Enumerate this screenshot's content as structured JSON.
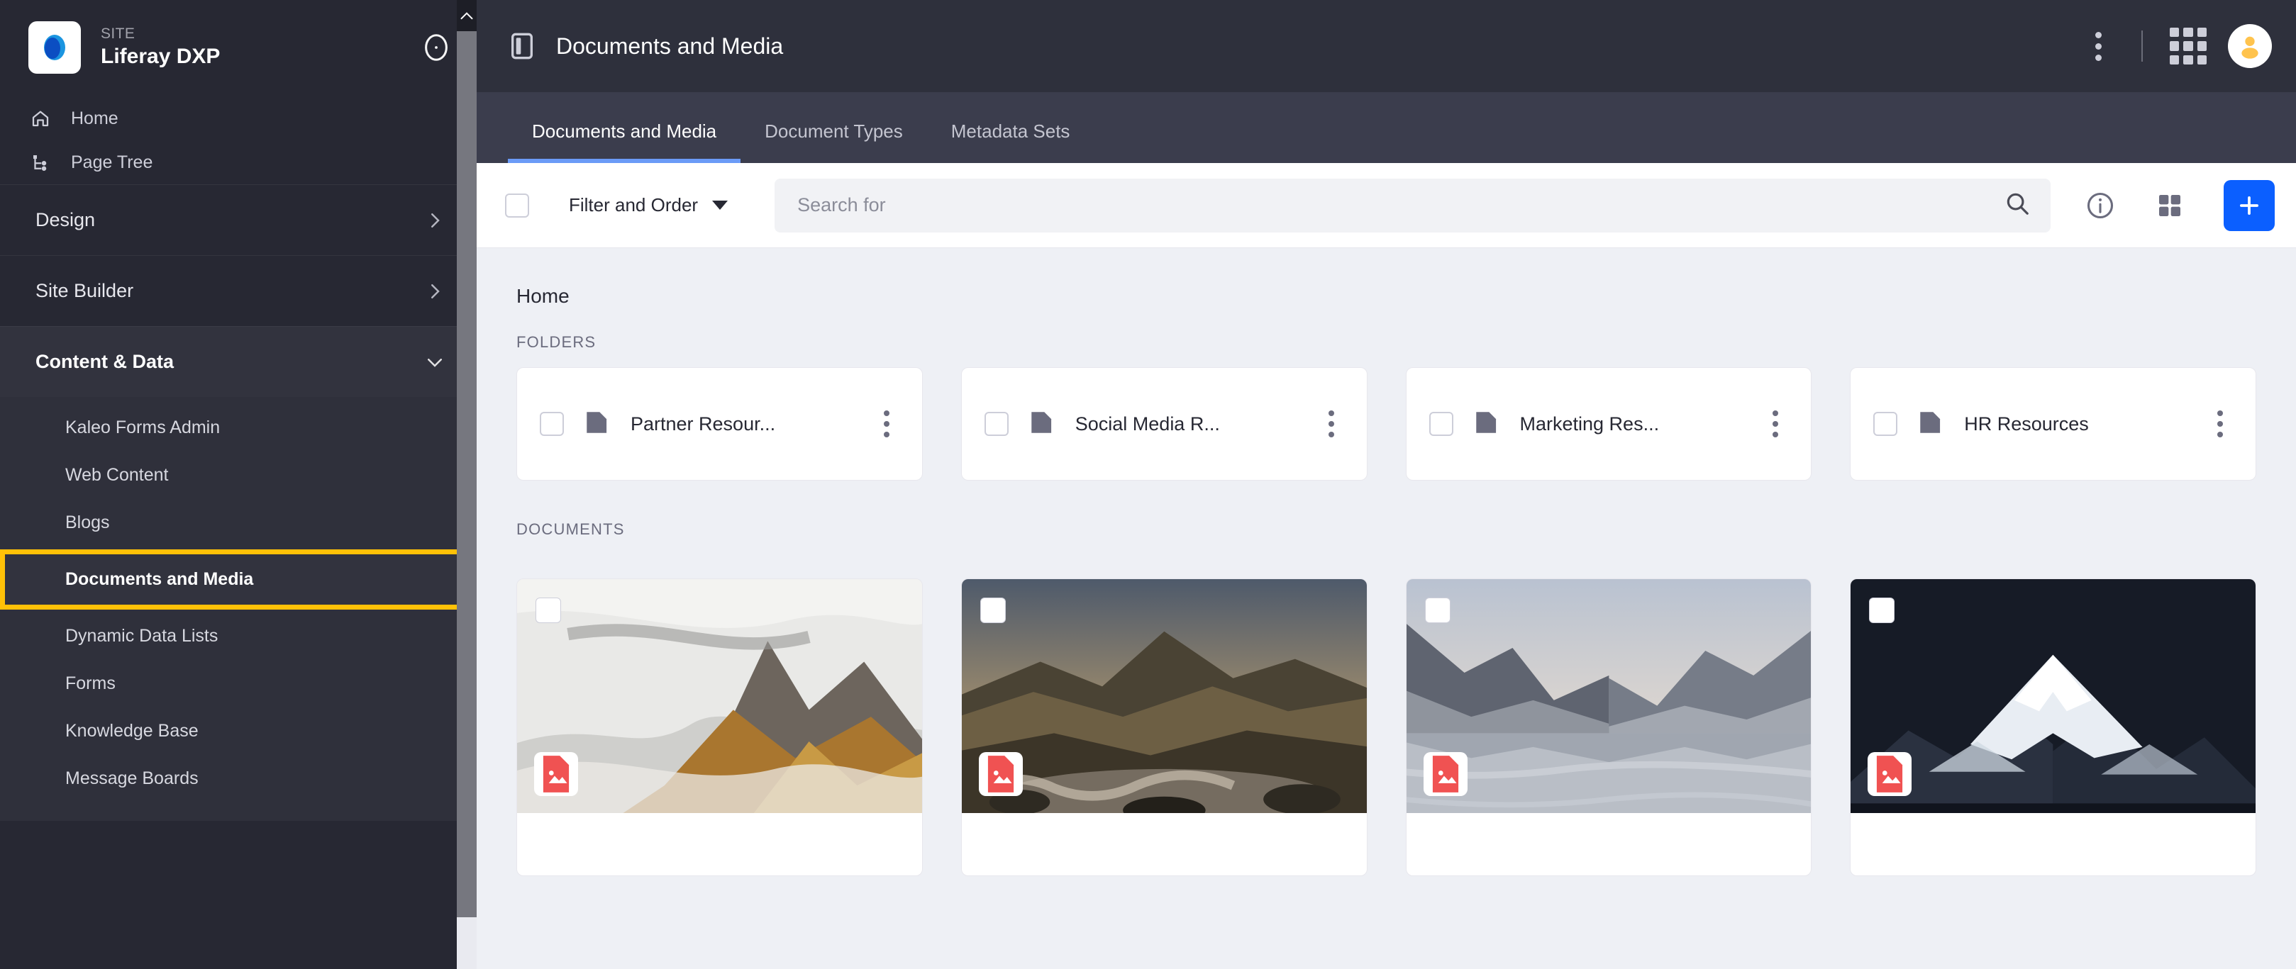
{
  "sidebar": {
    "kicker": "SITE",
    "title": "Liferay DXP",
    "logo_icon": "liferay-logo-icon",
    "compass_icon": "compass-icon",
    "links": [
      {
        "label": "Home",
        "icon": "home-icon"
      },
      {
        "label": "Page Tree",
        "icon": "page-tree-icon"
      }
    ],
    "groups": [
      {
        "label": "Design",
        "expanded": false,
        "icon": "chevron-right-icon"
      },
      {
        "label": "Site Builder",
        "expanded": false,
        "icon": "chevron-right-icon"
      },
      {
        "label": "Content & Data",
        "expanded": true,
        "icon": "chevron-down-icon"
      }
    ],
    "sub_items": [
      {
        "label": "Kaleo Forms Admin",
        "active": false
      },
      {
        "label": "Web Content",
        "active": false
      },
      {
        "label": "Blogs",
        "active": false
      },
      {
        "label": "Documents and Media",
        "active": true
      },
      {
        "label": "Dynamic Data Lists",
        "active": false
      },
      {
        "label": "Forms",
        "active": false
      },
      {
        "label": "Knowledge Base",
        "active": false
      },
      {
        "label": "Message Boards",
        "active": false
      }
    ],
    "highlight_color": "#ffc107"
  },
  "topbar": {
    "title": "Documents and Media",
    "panel_toggle_icon": "panel-toggle-icon",
    "kebab_icon": "kebab-menu-icon",
    "apps_icon": "apps-grid-icon",
    "avatar_icon": "user-avatar-icon"
  },
  "tabs": [
    {
      "label": "Documents and Media",
      "active": true
    },
    {
      "label": "Document Types",
      "active": false
    },
    {
      "label": "Metadata Sets",
      "active": false
    }
  ],
  "toolbar": {
    "select_all_checkbox": "select-all",
    "filter_label": "Filter and Order",
    "search_placeholder": "Search for",
    "search_value": "",
    "search_icon": "search-icon",
    "info_icon": "info-circle-icon",
    "view_icon": "grid-view-icon",
    "add_icon": "plus-icon",
    "add_color": "#0b5fff"
  },
  "content": {
    "breadcrumb": "Home",
    "folders_label": "FOLDERS",
    "documents_label": "DOCUMENTS",
    "folders": [
      {
        "name": "Partner Resour...",
        "icon": "folder-icon",
        "menu_icon": "kebab-menu-icon"
      },
      {
        "name": "Social Media R...",
        "icon": "folder-icon",
        "menu_icon": "kebab-menu-icon"
      },
      {
        "name": "Marketing Res...",
        "icon": "folder-icon",
        "menu_icon": "kebab-menu-icon"
      },
      {
        "name": "HR Resources",
        "icon": "folder-icon",
        "menu_icon": "kebab-menu-icon"
      }
    ],
    "documents": [
      {
        "thumb": "misty-mountain-peak",
        "badge_icon": "image-file-icon",
        "badge_color": "#f05252"
      },
      {
        "thumb": "rocky-stream-sunset",
        "badge_icon": "image-file-icon",
        "badge_color": "#f05252"
      },
      {
        "thumb": "lake-valley-dusk",
        "badge_icon": "image-file-icon",
        "badge_color": "#f05252"
      },
      {
        "thumb": "snow-peak-night",
        "badge_icon": "image-file-icon",
        "badge_color": "#f05252"
      }
    ]
  }
}
